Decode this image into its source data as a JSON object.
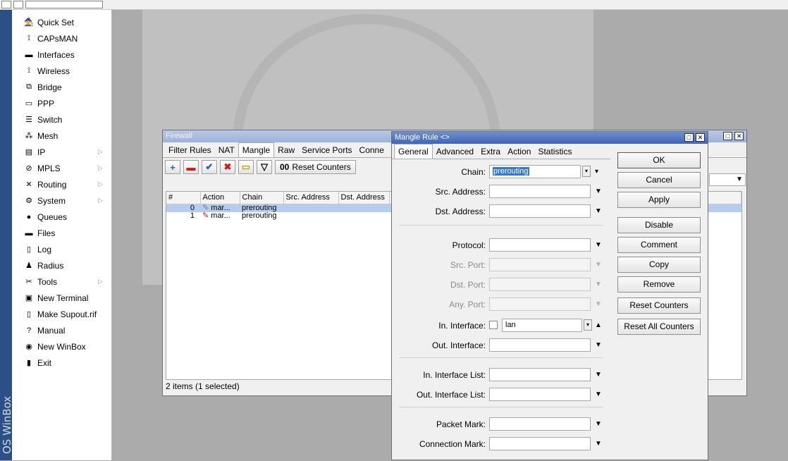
{
  "vertical_label": "OS WinBox",
  "sidebar": {
    "items": [
      {
        "label": "Quick Set",
        "icon": "wizard-icon",
        "glyph": "🧙",
        "arrow": false
      },
      {
        "label": "CAPsMAN",
        "icon": "antenna-icon",
        "glyph": "⟟",
        "arrow": false
      },
      {
        "label": "Interfaces",
        "icon": "interfaces-icon",
        "glyph": "▬",
        "arrow": false
      },
      {
        "label": "Wireless",
        "icon": "wireless-icon",
        "glyph": "⟟",
        "arrow": false
      },
      {
        "label": "Bridge",
        "icon": "bridge-icon",
        "glyph": "⧉",
        "arrow": false
      },
      {
        "label": "PPP",
        "icon": "ppp-icon",
        "glyph": "▭",
        "arrow": false
      },
      {
        "label": "Switch",
        "icon": "switch-icon",
        "glyph": "☰",
        "arrow": false
      },
      {
        "label": "Mesh",
        "icon": "mesh-icon",
        "glyph": "⁂",
        "arrow": false
      },
      {
        "label": "IP",
        "icon": "ip-icon",
        "glyph": "▤",
        "arrow": true
      },
      {
        "label": "MPLS",
        "icon": "mpls-icon",
        "glyph": "⊘",
        "arrow": true
      },
      {
        "label": "Routing",
        "icon": "routing-icon",
        "glyph": "✕",
        "arrow": true
      },
      {
        "label": "System",
        "icon": "system-icon",
        "glyph": "⚙",
        "arrow": true
      },
      {
        "label": "Queues",
        "icon": "queues-icon",
        "glyph": "●",
        "arrow": false
      },
      {
        "label": "Files",
        "icon": "files-icon",
        "glyph": "▬",
        "arrow": false
      },
      {
        "label": "Log",
        "icon": "log-icon",
        "glyph": "▯",
        "arrow": false
      },
      {
        "label": "Radius",
        "icon": "radius-icon",
        "glyph": "♟",
        "arrow": false
      },
      {
        "label": "Tools",
        "icon": "tools-icon",
        "glyph": "✂",
        "arrow": true
      },
      {
        "label": "New Terminal",
        "icon": "terminal-icon",
        "glyph": "▣",
        "arrow": false
      },
      {
        "label": "Make Supout.rif",
        "icon": "supout-icon",
        "glyph": "▯",
        "arrow": false
      },
      {
        "label": "Manual",
        "icon": "manual-icon",
        "glyph": "?",
        "arrow": false
      },
      {
        "label": "New WinBox",
        "icon": "winbox-icon",
        "glyph": "◉",
        "arrow": false
      },
      {
        "label": "Exit",
        "icon": "exit-icon",
        "glyph": "▮",
        "arrow": false
      }
    ]
  },
  "firewall": {
    "title": "Firewall",
    "tabs": [
      "Filter Rules",
      "NAT",
      "Mangle",
      "Raw",
      "Service Ports",
      "Conne"
    ],
    "active_tab": "Mangle",
    "toolbar": {
      "reset_counters": "Reset Counters",
      "counter_prefix": "00"
    },
    "columns": [
      "#",
      "Action",
      "Chain",
      "Src. Address",
      "Dst. Address"
    ],
    "rows": [
      {
        "num": "0",
        "action": "mar...",
        "chain": "prerouting",
        "selected": true
      },
      {
        "num": "1",
        "action": "mar...",
        "chain": "prerouting",
        "selected": false
      }
    ],
    "status": "2 items (1 selected)"
  },
  "mangle_rule": {
    "title": "Mangle Rule <>",
    "tabs": [
      "General",
      "Advanced",
      "Extra",
      "Action",
      "Statistics"
    ],
    "active_tab": "General",
    "fields": {
      "chain": {
        "label": "Chain:",
        "value": "prerouting"
      },
      "src_address": {
        "label": "Src. Address:",
        "value": ""
      },
      "dst_address": {
        "label": "Dst. Address:",
        "value": ""
      },
      "protocol": {
        "label": "Protocol:",
        "value": ""
      },
      "src_port": {
        "label": "Src. Port:",
        "value": ""
      },
      "dst_port": {
        "label": "Dst. Port:",
        "value": ""
      },
      "any_port": {
        "label": "Any. Port:",
        "value": ""
      },
      "in_interface": {
        "label": "In. Interface:",
        "value": "lan"
      },
      "out_interface": {
        "label": "Out. Interface:",
        "value": ""
      },
      "in_interface_list": {
        "label": "In. Interface List:",
        "value": ""
      },
      "out_interface_list": {
        "label": "Out. Interface List:",
        "value": ""
      },
      "packet_mark": {
        "label": "Packet Mark:",
        "value": ""
      },
      "connection_mark": {
        "label": "Connection Mark:",
        "value": ""
      }
    },
    "buttons": [
      "OK",
      "Cancel",
      "Apply",
      "Disable",
      "Comment",
      "Copy",
      "Remove",
      "Reset Counters",
      "Reset All Counters"
    ]
  },
  "colors": {
    "title_active": "#3f65b8",
    "selection": "#b5cdef",
    "strip": "#2b4f86"
  }
}
